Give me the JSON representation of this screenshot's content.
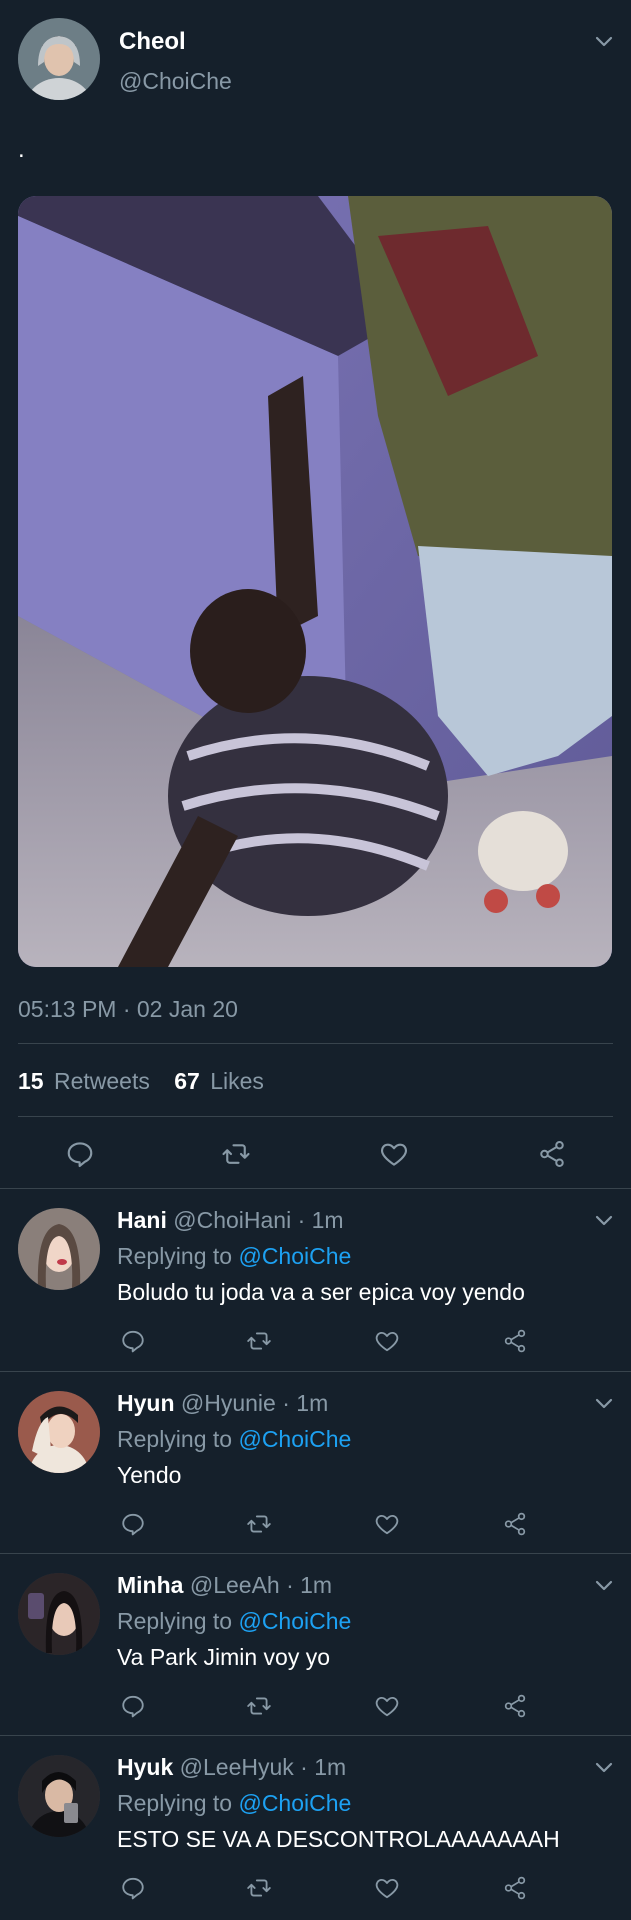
{
  "tweet": {
    "author_name": "Cheol",
    "author_handle": "@ChoiChe",
    "text": ".",
    "timestamp": "05:13 PM · 02 Jan 20",
    "retweets_count": "15",
    "retweets_label": "Retweets",
    "likes_count": "67",
    "likes_label": "Likes"
  },
  "replies": [
    {
      "name": "Hani",
      "meta": "@ChoiHani · 1m",
      "replying_prefix": "Replying to",
      "replying_to": "@ChoiChe",
      "text": "Boludo tu joda va a ser epica voy yendo",
      "avatar_color": "#c9a89a"
    },
    {
      "name": "Hyun",
      "meta": "@Hyunie · 1m",
      "replying_prefix": "Replying to",
      "replying_to": "@ChoiChe",
      "text": "Yendo",
      "avatar_color": "#d9c8b5"
    },
    {
      "name": "Minha",
      "meta": "@LeeAh · 1m",
      "replying_prefix": "Replying to",
      "replying_to": "@ChoiChe",
      "text": "Va Park Jimin voy yo",
      "avatar_color": "#3c3438"
    },
    {
      "name": "Hyuk",
      "meta": "@LeeHyuk · 1m",
      "replying_prefix": "Replying to",
      "replying_to": "@ChoiChe",
      "text": "ESTO SE VA A DESCONTROLAAAAAAAH",
      "avatar_color": "#2a2a2e"
    }
  ],
  "icons": {
    "reply": "comment-icon",
    "retweet": "retweet-icon",
    "like": "heart-icon",
    "share": "share-icon",
    "menu": "chevron-down-icon"
  },
  "colors": {
    "background": "#15202b",
    "link": "#1da1f2",
    "muted": "#8899a6",
    "divider": "#38444d"
  }
}
